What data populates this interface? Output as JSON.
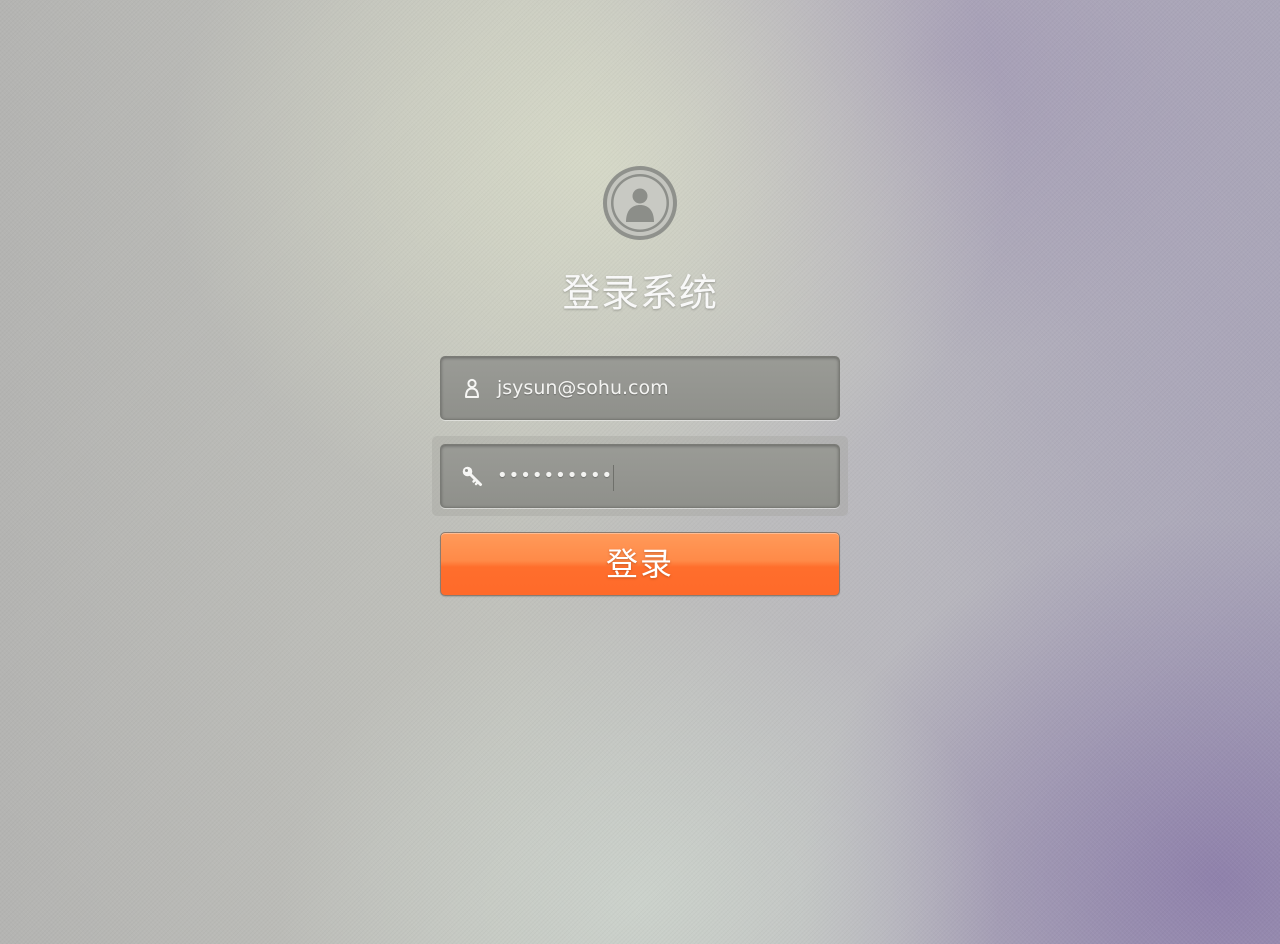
{
  "login": {
    "title": "登录系统",
    "username_value": "jsysun@sohu.com",
    "password_masked": "••••••••••",
    "submit_label": "登录"
  },
  "icons": {
    "avatar": "user-avatar-icon",
    "username": "user-icon",
    "password": "key-icon"
  },
  "colors": {
    "button_accent": "#ff7a36",
    "title_text": "#f8f8f8"
  }
}
